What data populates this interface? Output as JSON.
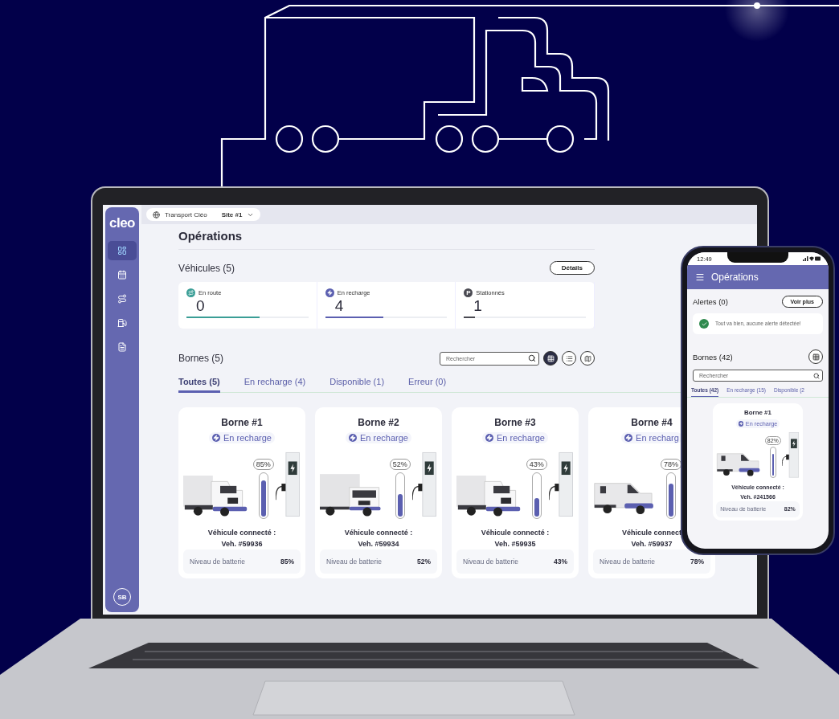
{
  "sidebar": {
    "logo": "cleo",
    "items": [
      {
        "selected": true
      },
      {
        "selected": false
      },
      {
        "selected": false
      },
      {
        "selected": false
      },
      {
        "selected": false
      }
    ],
    "avatar": "SB"
  },
  "topbar": {
    "company": "Transport Cléo",
    "site": "Site #1"
  },
  "page": {
    "title": "Opérations"
  },
  "vehicles": {
    "title": "Véhicules (5)",
    "details_button": "Détails",
    "stats": [
      {
        "label": "En route",
        "value": "0",
        "level": 0.6,
        "color": "#3a9e96"
      },
      {
        "label": "En recharge",
        "value": "4",
        "level": 0.48,
        "color": "#5b5fb0"
      },
      {
        "label": "Stationnés",
        "value": "1",
        "level": 0.09,
        "color": "#4a4a52",
        "glyph": "P"
      }
    ]
  },
  "stations": {
    "title": "Bornes (5)",
    "search": {
      "placeholder": "Rechercher"
    },
    "views": [
      {
        "selected": true
      },
      {
        "selected": false
      },
      {
        "selected": false
      }
    ],
    "tabs": [
      {
        "label": "Toutes (5)",
        "selected": true
      },
      {
        "label": "En recharge (4)",
        "selected": false
      },
      {
        "label": "Disponible (1)",
        "selected": false
      },
      {
        "label": "Erreur (0)",
        "selected": false
      }
    ],
    "cards": [
      {
        "title": "Borne #1",
        "status": "En recharge",
        "percent": "85%",
        "level": 0.85,
        "kind": "truck",
        "connected_label": "Véhicule connecté :",
        "vehicle_id": "Veh. #59936",
        "battery_label": "Niveau de batterie",
        "battery_value": "85%"
      },
      {
        "title": "Borne #2",
        "status": "En recharge",
        "percent": "52%",
        "level": 0.52,
        "kind": "box-truck",
        "connected_label": "Véhicule connecté :",
        "vehicle_id": "Veh. #59934",
        "battery_label": "Niveau de batterie",
        "battery_value": "52%"
      },
      {
        "title": "Borne #3",
        "status": "En recharge",
        "percent": "43%",
        "level": 0.43,
        "kind": "truck",
        "connected_label": "Véhicule connecté :",
        "vehicle_id": "Veh. #59935",
        "battery_label": "Niveau de batterie",
        "battery_value": "43%"
      },
      {
        "title": "Borne #4",
        "status": "En recharg",
        "percent": "78%",
        "level": 0.78,
        "kind": "van",
        "connected_label": "Véhicule connect",
        "vehicle_id": "Veh. #59937",
        "battery_label": "Niveau de batterie",
        "battery_value": "78%"
      }
    ]
  },
  "phone": {
    "time": "12:49",
    "title": "Opérations",
    "alerts": {
      "title": "Alertes (0)",
      "button": "Voir plus",
      "message": "Tout va bien, aucune alerte détectée!"
    },
    "stations": {
      "title": "Bornes (42)",
      "search": {
        "placeholder": "Rechercher"
      },
      "tabs": [
        {
          "label": "Toutes (42)",
          "selected": true
        },
        {
          "label": "En recharge (15)",
          "selected": false
        },
        {
          "label": "Disponible (2",
          "selected": false
        }
      ],
      "card": {
        "title": "Borne #1",
        "status": "En recharge",
        "percent": "82%",
        "level": 0.82,
        "kind": "van",
        "connected_label": "Véhicule connecté :",
        "vehicle_id": "Veh. #241566",
        "battery_label": "Niveau de batterie",
        "battery_value": "82%"
      }
    }
  }
}
